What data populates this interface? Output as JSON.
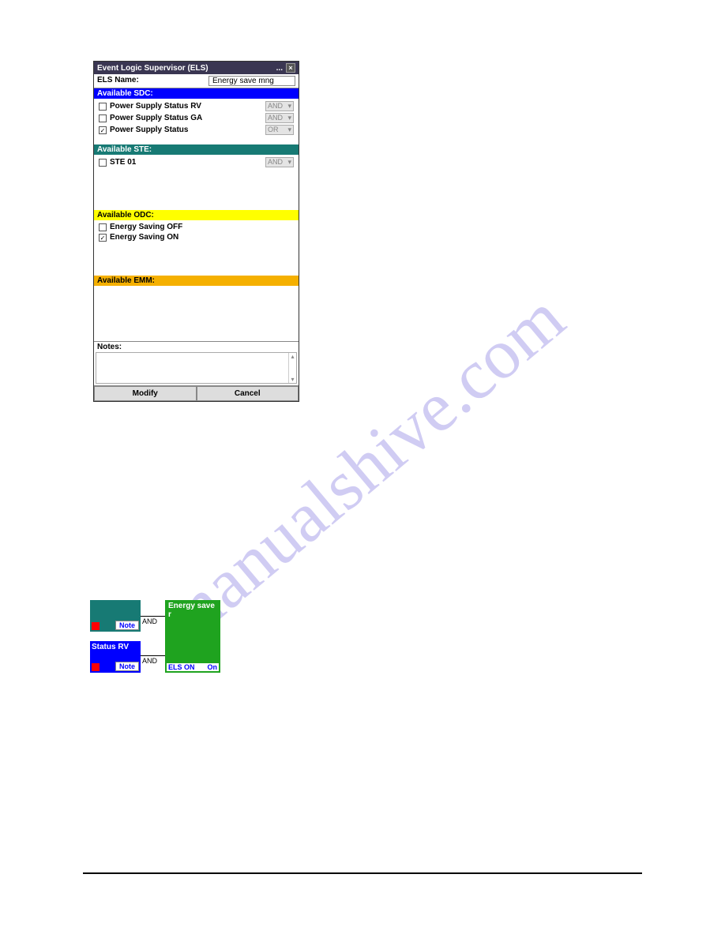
{
  "window": {
    "title": "Event Logic Supervisor (ELS)",
    "name_label": "ELS Name:",
    "name_value": "Energy save mng"
  },
  "sdc": {
    "header": "Available SDC:",
    "items": [
      {
        "label": "Power Supply Status RV",
        "checked": false,
        "dd": "AND"
      },
      {
        "label": "Power Supply Status GA",
        "checked": false,
        "dd": "AND"
      },
      {
        "label": "Power Supply Status",
        "checked": true,
        "dd": "OR"
      }
    ]
  },
  "ste": {
    "header": "Available STE:",
    "items": [
      {
        "label": "STE 01",
        "checked": false,
        "dd": "AND"
      }
    ]
  },
  "odc": {
    "header": "Available ODC:",
    "items": [
      {
        "label": "Energy Saving OFF",
        "checked": false
      },
      {
        "label": "Energy Saving ON",
        "checked": true
      }
    ]
  },
  "emm": {
    "header": "Available EMM:"
  },
  "notes_label": "Notes:",
  "buttons": {
    "modify": "Modify",
    "cancel": "Cancel"
  },
  "diagram": {
    "note": "Note",
    "and": "AND",
    "status_rv": "Status RV",
    "energy_save": "Energy save r",
    "els_on": "ELS ON",
    "on": "On"
  },
  "watermark": "manualshive.com"
}
